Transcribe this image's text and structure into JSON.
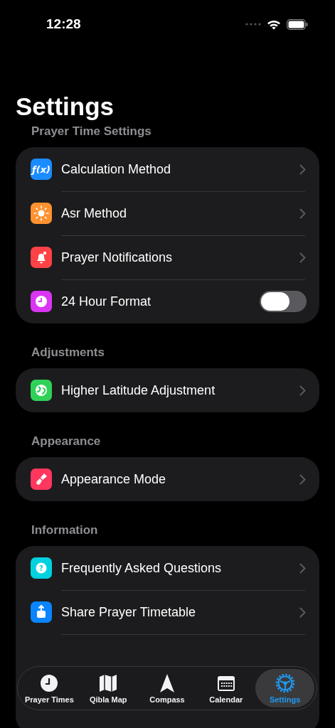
{
  "status_bar": {
    "time": "12:28"
  },
  "title": "Settings",
  "sections": [
    {
      "header": "Prayer Time Settings",
      "rows": [
        {
          "kind": "link",
          "label": "Calculation Method",
          "color": "#1a8cff",
          "icon_text": "ƒ(x)"
        },
        {
          "kind": "link",
          "label": "Asr Method",
          "color": "#ff9230"
        },
        {
          "kind": "link",
          "label": "Prayer Notifications",
          "color": "#ff4245"
        },
        {
          "kind": "toggle",
          "label": "24 Hour Format",
          "color": "#db34f2",
          "on": false
        }
      ]
    },
    {
      "header": "Adjustments",
      "rows": [
        {
          "kind": "link",
          "label": "Higher Latitude Adjustment",
          "color": "#30d158"
        }
      ]
    },
    {
      "header": "Appearance",
      "rows": [
        {
          "kind": "link",
          "label": "Appearance Mode",
          "color": "#ff375f"
        }
      ]
    },
    {
      "header": "Information",
      "rows": [
        {
          "kind": "link",
          "label": "Frequently Asked Questions",
          "color": "#00d2e0",
          "icon_text": "?"
        },
        {
          "kind": "link",
          "label": "Share Prayer Timetable",
          "color": "#0a84ff"
        }
      ]
    }
  ],
  "tab_bar": [
    {
      "label": "Prayer Times",
      "selected": false
    },
    {
      "label": "Qibla Map",
      "selected": false
    },
    {
      "label": "Compass",
      "selected": false
    },
    {
      "label": "Calendar",
      "selected": false
    },
    {
      "label": "Settings",
      "selected": true
    }
  ]
}
